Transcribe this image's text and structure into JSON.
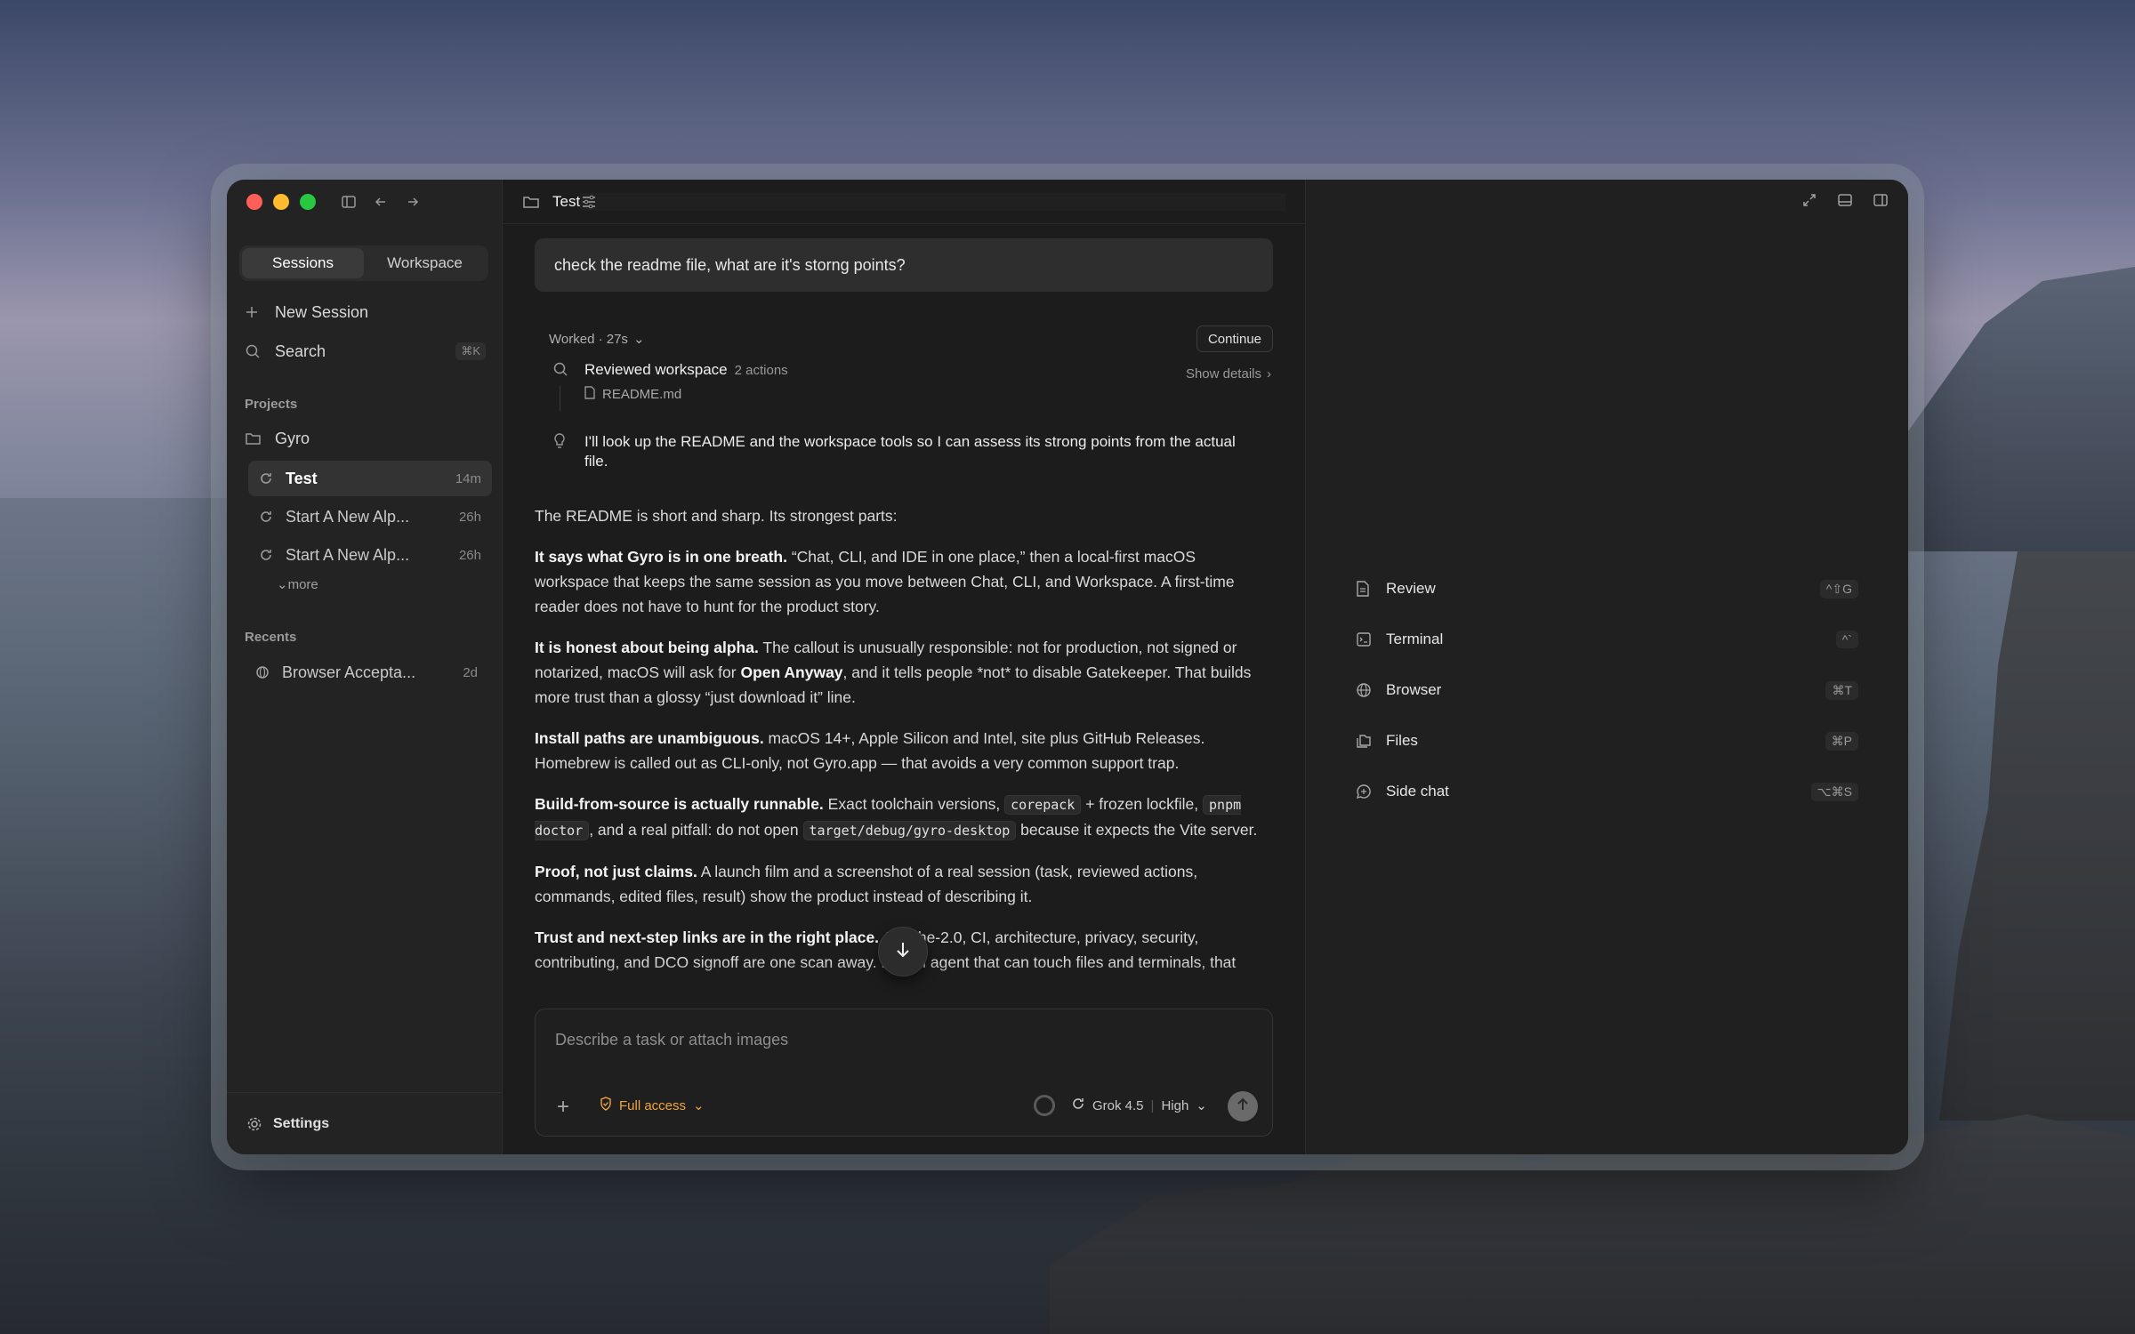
{
  "sidebar": {
    "tabs": [
      "Sessions",
      "Workspace"
    ],
    "new_session": "New Session",
    "search": "Search",
    "search_shortcut": "⌘K",
    "projects_label": "Projects",
    "project_name": "Gyro",
    "sessions": [
      {
        "title": "Test",
        "age": "14m"
      },
      {
        "title": "Start A New Alp...",
        "age": "26h"
      },
      {
        "title": "Start A New Alp...",
        "age": "26h"
      }
    ],
    "more": "more",
    "recents_label": "Recents",
    "recents": [
      {
        "title": "Browser Accepta...",
        "age": "2d"
      }
    ],
    "settings": "Settings"
  },
  "main": {
    "header_title": "Test",
    "user_message": "check the readme file, what are it's storng points?",
    "worked_label": "Worked · 27s",
    "continue_label": "Continue",
    "step": {
      "title": "Reviewed workspace",
      "meta": "2 actions",
      "file": "README.md",
      "show_details": "Show details"
    },
    "thought": "I'll look up the README and the workspace tools so I can assess its strong points from the actual file.",
    "answer": {
      "intro": "The README is short and sharp. Its strongest parts:",
      "p1_bold": "It says what Gyro is in one breath.",
      "p1_text": " “Chat, CLI, and IDE in one place,” then a local-first macOS workspace that keeps the same session as you move between Chat, CLI, and Workspace. A first-time reader does not have to hunt for the product story.",
      "p2_bold": "It is honest about being alpha.",
      "p2_text1": " The callout is unusually responsible: not for production, not signed or notarized, macOS will ask for ",
      "p2_bold2": "Open Anyway",
      "p2_text2": ", and it tells people *not* to disable Gatekeeper. That builds more trust than a glossy “just download it” line.",
      "p3_bold": "Install paths are unambiguous.",
      "p3_text": " macOS 14+, Apple Silicon and Intel, site plus GitHub Releases. Homebrew is called out as CLI-only, not Gyro.app — that avoids a very common support trap.",
      "p4_bold": "Build-from-source is actually runnable.",
      "p4_text1": " Exact toolchain versions, ",
      "p4_code1": "corepack",
      "p4_text2": " + frozen lockfile, ",
      "p4_code2": "pnpm doctor",
      "p4_text3": ", and a real pitfall: do not open ",
      "p4_code3": "target/debug/gyro-desktop",
      "p4_text4": " because it expects the Vite server.",
      "p5_bold": "Proof, not just claims.",
      "p5_text": " A launch film and a screenshot of a real session (task, reviewed actions, commands, edited files, result) show the product instead of describing it.",
      "p6_bold": "Trust and next-step links are in the right place.",
      "p6_text": " Apache-2.0, CI, architecture, privacy, security, contributing, and DCO signoff are one scan away. For an agent that can touch files and terminals, that"
    },
    "composer": {
      "placeholder": "Describe a task or attach images",
      "access": "Full access",
      "model": "Grok 4.5",
      "effort": "High"
    }
  },
  "right_panel": {
    "tools": [
      {
        "label": "Review",
        "shortcut": "^⇧G"
      },
      {
        "label": "Terminal",
        "shortcut": "^`"
      },
      {
        "label": "Browser",
        "shortcut": "⌘T"
      },
      {
        "label": "Files",
        "shortcut": "⌘P"
      },
      {
        "label": "Side chat",
        "shortcut": "⌥⌘S"
      }
    ]
  },
  "colors": {
    "accent_orange": "#f0a640",
    "traffic_red": "#ff5f57",
    "traffic_yellow": "#febc2e",
    "traffic_green": "#28c840"
  }
}
